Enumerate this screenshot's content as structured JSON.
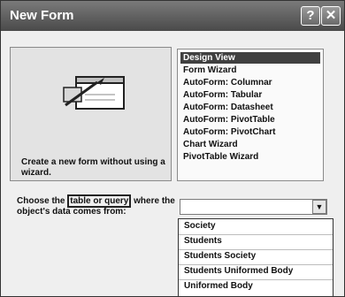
{
  "window": {
    "title": "New Form",
    "help_glyph": "?",
    "close_glyph": "✕"
  },
  "preview": {
    "icon": "form-design-icon",
    "description": "Create a new form without using a wizard."
  },
  "options": {
    "items": [
      {
        "label": "Design View",
        "selected": true
      },
      {
        "label": "Form Wizard"
      },
      {
        "label": "AutoForm: Columnar"
      },
      {
        "label": "AutoForm: Tabular"
      },
      {
        "label": "AutoForm: Datasheet"
      },
      {
        "label": "AutoForm: PivotTable"
      },
      {
        "label": "AutoForm: PivotChart"
      },
      {
        "label": "Chart Wizard"
      },
      {
        "label": "PivotTable Wizard"
      }
    ]
  },
  "source_prompt": {
    "before": "Choose the ",
    "highlight": "table or query",
    "after": " where the object's data comes from:"
  },
  "source_combo": {
    "value": "",
    "arrow_icon": "chevron-down-icon"
  },
  "dropdown": {
    "items": [
      "Society",
      "Students",
      "Students Society",
      "Students Uniformed Body",
      "Uniformed Body"
    ]
  },
  "colors": {
    "titlebar": "#5a5a5a",
    "selection": "#404040",
    "dialog_bg": "#efefef"
  }
}
